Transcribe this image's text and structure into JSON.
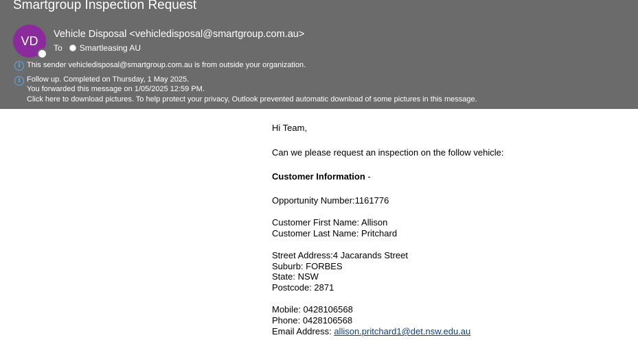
{
  "email": {
    "subject": "Smartgroup Inspection Request",
    "avatar_initials": "VD",
    "sender": "Vehicle Disposal <vehicledisposal@smartgroup.com.au>",
    "to_label": "To",
    "recipient": "Smartleasing AU",
    "external_notice": "This sender vehicledisposal@smartgroup.com.au is from outside your organization.",
    "followup_line1": "Follow up.  Completed on Thursday, 1 May 2025.",
    "followup_line2": "You forwarded this message on 1/05/2025 12:59 PM.",
    "followup_line3": "Click here to download pictures. To help protect your privacy, Outlook prevented automatic download of some pictures in this message."
  },
  "body": {
    "greeting": "Hi Team,",
    "request": "Can we please request an inspection on the follow vehicle:",
    "section_title": "Customer Information",
    "section_suffix": " -",
    "opportunity": "Opportunity Number:1161776",
    "first_name": "Customer First Name: Allison",
    "last_name": "Customer Last Name: Pritchard",
    "street": "Street Address:4 Jacarands Street",
    "suburb": "Suburb: FORBES",
    "state": "State: NSW",
    "postcode": "Postcode: 2871",
    "mobile": "Mobile: 0428106568",
    "phone": "Phone: 0428106568",
    "email_label": "Email Address: ",
    "email_address": "allison.pritchard1@det.nsw.edu.au"
  },
  "colors": {
    "header_bg": "#6b6b6b",
    "avatar_bg": "#8b2a9c",
    "info_icon": "#5aa9e6",
    "link": "#0b3d91"
  },
  "icons": {
    "info": "info-icon",
    "presence": "presence-icon",
    "recipient_status": "status-dot-icon"
  }
}
